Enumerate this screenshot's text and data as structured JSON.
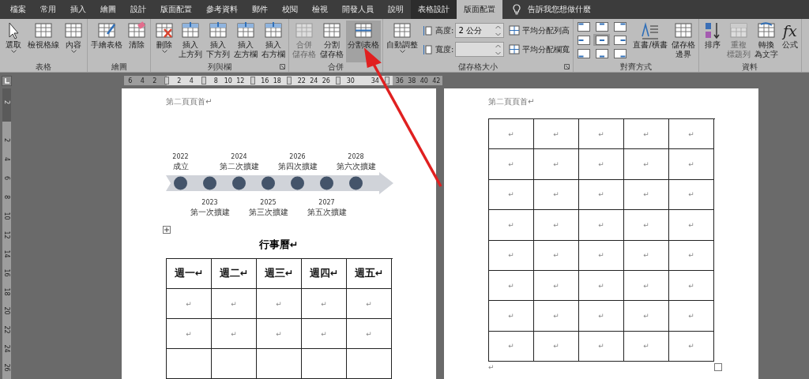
{
  "tabs": [
    {
      "label": "檔案",
      "selected": false,
      "contextual": false
    },
    {
      "label": "常用",
      "selected": false,
      "contextual": false
    },
    {
      "label": "插入",
      "selected": false,
      "contextual": false
    },
    {
      "label": "繪圖",
      "selected": false,
      "contextual": false
    },
    {
      "label": "設計",
      "selected": false,
      "contextual": false
    },
    {
      "label": "版面配置",
      "selected": false,
      "contextual": false
    },
    {
      "label": "參考資料",
      "selected": false,
      "contextual": false
    },
    {
      "label": "郵件",
      "selected": false,
      "contextual": false
    },
    {
      "label": "校閱",
      "selected": false,
      "contextual": false
    },
    {
      "label": "檢視",
      "selected": false,
      "contextual": false
    },
    {
      "label": "開發人員",
      "selected": false,
      "contextual": false
    },
    {
      "label": "說明",
      "selected": false,
      "contextual": false
    },
    {
      "label": "表格設計",
      "selected": false,
      "contextual": true
    },
    {
      "label": "版面配置",
      "selected": true,
      "contextual": true
    }
  ],
  "tell_me": {
    "label": "告訴我您想做什麼"
  },
  "ribbon": {
    "groups": [
      {
        "label": "表格",
        "launcher": false,
        "items": [
          {
            "kind": "large",
            "label": [
              "選取"
            ],
            "menu": true,
            "disabled": false,
            "highlighted": false
          },
          {
            "kind": "large",
            "label": [
              "檢視格線"
            ],
            "menu": false,
            "disabled": false,
            "highlighted": false
          },
          {
            "kind": "large",
            "label": [
              "內容"
            ],
            "menu": true,
            "disabled": false,
            "highlighted": false
          }
        ]
      },
      {
        "label": "繪圖",
        "launcher": false,
        "items": [
          {
            "kind": "large",
            "label": [
              "手繪表格"
            ],
            "menu": false,
            "disabled": false,
            "highlighted": false
          },
          {
            "kind": "large",
            "label": [
              "清除"
            ],
            "menu": false,
            "disabled": false,
            "highlighted": false
          }
        ]
      },
      {
        "label": "列與欄",
        "launcher": true,
        "items": [
          {
            "kind": "large",
            "label": [
              "刪除"
            ],
            "menu": true,
            "disabled": false,
            "highlighted": false
          },
          {
            "kind": "large",
            "label": [
              "插入",
              "上方列"
            ],
            "menu": false,
            "disabled": false,
            "highlighted": false
          },
          {
            "kind": "large",
            "label": [
              "插入",
              "下方列"
            ],
            "menu": false,
            "disabled": false,
            "highlighted": false
          },
          {
            "kind": "large",
            "label": [
              "插入",
              "左方欄"
            ],
            "menu": false,
            "disabled": false,
            "highlighted": false
          },
          {
            "kind": "large",
            "label": [
              "插入",
              "右方欄"
            ],
            "menu": false,
            "disabled": false,
            "highlighted": false
          }
        ]
      },
      {
        "label": "合併",
        "launcher": false,
        "items": [
          {
            "kind": "large",
            "label": [
              "合併",
              "儲存格"
            ],
            "menu": false,
            "disabled": true,
            "highlighted": false
          },
          {
            "kind": "large",
            "label": [
              "分割",
              "儲存格"
            ],
            "menu": false,
            "disabled": false,
            "highlighted": false
          },
          {
            "kind": "large",
            "label": [
              "分割表格"
            ],
            "menu": false,
            "disabled": false,
            "highlighted": true
          }
        ]
      },
      {
        "label": "儲存格大小",
        "launcher": true,
        "items": [
          {
            "kind": "large",
            "label": [
              "自動調整"
            ],
            "menu": true,
            "disabled": false,
            "highlighted": false
          },
          {
            "kind": "stack",
            "items": [
              {
                "kind": "field",
                "label": "高度:",
                "value": "2 公分"
              },
              {
                "kind": "field",
                "label": "寬度:",
                "value": ""
              }
            ]
          },
          {
            "kind": "stack",
            "items": [
              {
                "kind": "small",
                "label": "平均分配列高"
              },
              {
                "kind": "small",
                "label": "平均分配欄寬"
              }
            ]
          }
        ]
      },
      {
        "label": "對齊方式",
        "launcher": false,
        "items": [
          {
            "kind": "align_grid",
            "cells": [
              {
                "selected": false
              },
              {
                "selected": false
              },
              {
                "selected": false
              },
              {
                "selected": false
              },
              {
                "selected": true
              },
              {
                "selected": false
              },
              {
                "selected": false
              },
              {
                "selected": false
              },
              {
                "selected": false
              }
            ]
          },
          {
            "kind": "large",
            "label": [
              "直書/橫書"
            ],
            "menu": false,
            "disabled": false,
            "highlighted": false
          },
          {
            "kind": "large",
            "label": [
              "儲存格",
              "邊界"
            ],
            "menu": false,
            "disabled": false,
            "highlighted": false
          }
        ]
      },
      {
        "label": "資料",
        "launcher": false,
        "items": [
          {
            "kind": "large",
            "label": [
              "排序"
            ],
            "menu": false,
            "disabled": false,
            "highlighted": false
          },
          {
            "kind": "large",
            "label": [
              "重複",
              "標題列"
            ],
            "menu": false,
            "disabled": true,
            "highlighted": false
          },
          {
            "kind": "large",
            "label": [
              "轉換",
              "為文字"
            ],
            "menu": false,
            "disabled": false,
            "highlighted": false
          },
          {
            "kind": "large",
            "label": [
              "公式"
            ],
            "glyph": "fx",
            "menu": false,
            "disabled": false,
            "highlighted": false
          }
        ]
      }
    ]
  },
  "ruler": {
    "marks": [
      {
        "kind": "num",
        "text": "6"
      },
      {
        "kind": "num",
        "text": "4"
      },
      {
        "kind": "num",
        "text": "2"
      },
      {
        "kind": "marker"
      },
      {
        "kind": "num",
        "text": "2"
      },
      {
        "kind": "num",
        "text": "4"
      },
      {
        "kind": "marker"
      },
      {
        "kind": "num",
        "text": "8"
      },
      {
        "kind": "num",
        "text": "10"
      },
      {
        "kind": "num",
        "text": "12"
      },
      {
        "kind": "marker"
      },
      {
        "kind": "num",
        "text": "16"
      },
      {
        "kind": "num",
        "text": "18"
      },
      {
        "kind": "marker"
      },
      {
        "kind": "num",
        "text": "22"
      },
      {
        "kind": "num",
        "text": "24"
      },
      {
        "kind": "num",
        "text": "26"
      },
      {
        "kind": "marker"
      },
      {
        "kind": "num",
        "text": "30"
      },
      {
        "kind": "gap"
      },
      {
        "kind": "num",
        "text": "34"
      },
      {
        "kind": "marker"
      },
      {
        "kind": "num",
        "text": "36"
      },
      {
        "kind": "num",
        "text": "38"
      },
      {
        "kind": "num",
        "text": "40"
      },
      {
        "kind": "num",
        "text": "42"
      }
    ]
  },
  "vertical_ruler": {
    "marks": [
      {
        "kind": "num",
        "text": "2"
      },
      {
        "kind": "gap"
      },
      {
        "kind": "num",
        "text": "2"
      },
      {
        "kind": "num",
        "text": "4"
      },
      {
        "kind": "num",
        "text": "6"
      },
      {
        "kind": "num",
        "text": "8"
      },
      {
        "kind": "num",
        "text": "10"
      },
      {
        "kind": "num",
        "text": "12"
      },
      {
        "kind": "num",
        "text": "14"
      },
      {
        "kind": "num",
        "text": "16"
      },
      {
        "kind": "num",
        "text": "18"
      },
      {
        "kind": "num",
        "text": "20"
      },
      {
        "kind": "num",
        "text": "22"
      },
      {
        "kind": "num",
        "text": "24"
      },
      {
        "kind": "num",
        "text": "26"
      }
    ]
  },
  "pages": [
    {
      "header": "第二頁頁首↵",
      "timeline": [
        {
          "year": "2022",
          "text": "成立"
        },
        {
          "year": "2023",
          "text": "第一次擴建"
        },
        {
          "year": "2024",
          "text": "第二次擴建"
        },
        {
          "year": "2025",
          "text": "第三次擴建"
        },
        {
          "year": "2026",
          "text": "第四次擴建"
        },
        {
          "year": "2027",
          "text": "第五次擴建"
        },
        {
          "year": "2028",
          "text": "第六次擴建"
        }
      ],
      "title": "行事曆↵",
      "table": {
        "header": [
          "週一↵",
          "週二↵",
          "週三↵",
          "週四↵",
          "週五↵"
        ],
        "rows": [
          [
            "↵",
            "↵",
            "↵",
            "↵",
            "↵"
          ],
          [
            "↵",
            "↵",
            "↵",
            "↵",
            "↵"
          ]
        ]
      }
    },
    {
      "header": "第二頁頁首↵",
      "table": {
        "rows": [
          [
            "↵",
            "↵",
            "↵",
            "↵",
            "↵"
          ],
          [
            "↵",
            "↵",
            "↵",
            "↵",
            "↵"
          ],
          [
            "↵",
            "↵",
            "↵",
            "↵",
            "↵"
          ],
          [
            "↵",
            "↵",
            "↵",
            "↵",
            "↵"
          ],
          [
            "↵",
            "↵",
            "↵",
            "↵",
            "↵"
          ],
          [
            "↵",
            "↵",
            "↵",
            "↵",
            "↵"
          ],
          [
            "↵",
            "↵",
            "↵",
            "↵",
            "↵"
          ],
          [
            "↵",
            "↵",
            "↵",
            "↵",
            "↵"
          ]
        ]
      },
      "end_mark": "↵"
    }
  ],
  "annotation": {
    "kind": "arrow"
  }
}
